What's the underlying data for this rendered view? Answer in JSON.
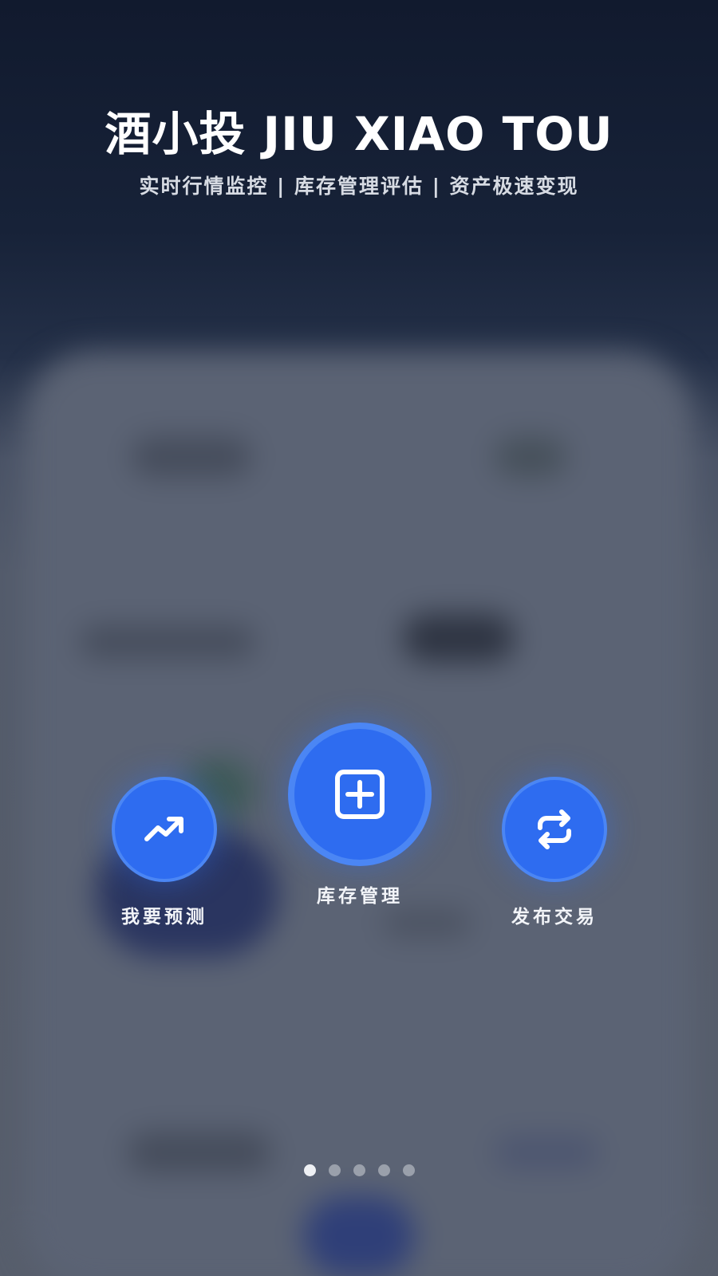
{
  "header": {
    "title": "酒小投 JIU XIAO TOU",
    "subtitle": "实时行情监控 | 库存管理评估 | 资产极速变现"
  },
  "actions": [
    {
      "label": "我要预测",
      "icon": "trending-up-icon"
    },
    {
      "label": "库存管理",
      "icon": "plus-square-icon"
    },
    {
      "label": "发布交易",
      "icon": "repeat-icon"
    }
  ],
  "pager": {
    "total": 5,
    "active_index": 0
  },
  "colors": {
    "accent": "#2e6cf0",
    "accent_border": "#4b86f4",
    "background_top": "#111a2e",
    "overlay": "#555c6a"
  }
}
